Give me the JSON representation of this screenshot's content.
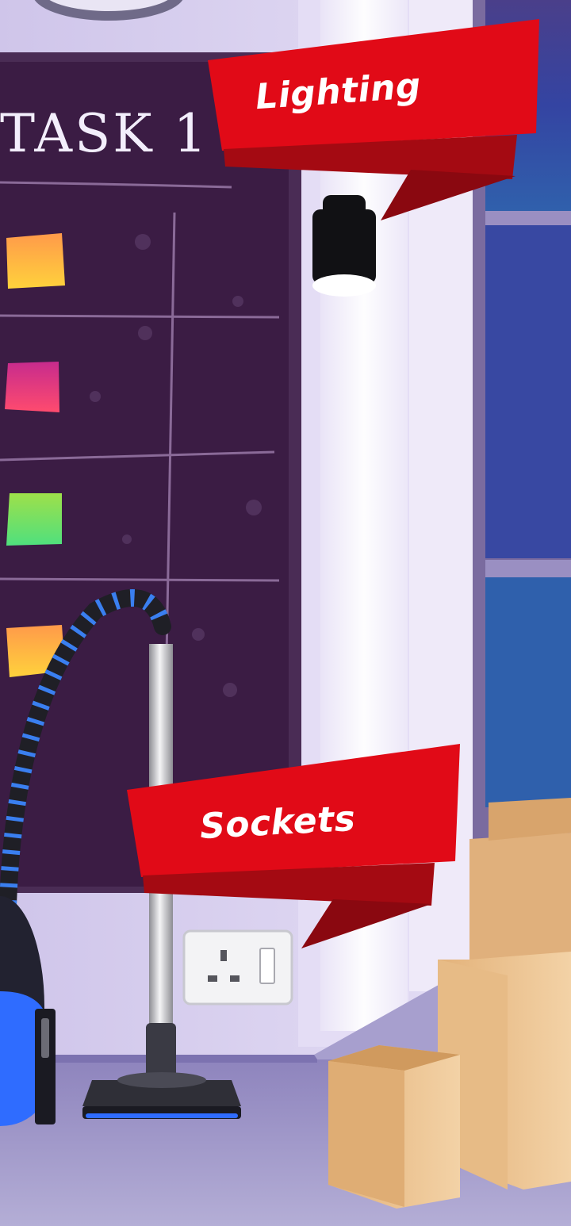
{
  "board": {
    "title": "TASK 1"
  },
  "hotspots": {
    "lighting": {
      "label": "Lighting",
      "icon": "ceiling-spotlight-icon"
    },
    "sockets": {
      "label": "Sockets",
      "icon": "wall-socket-icon"
    }
  },
  "colors": {
    "banner_red": "#e10a17",
    "banner_dark_red": "#9b0a10",
    "board_purple": "#3b1c44",
    "wall_lavender": "#d8d0ec",
    "window_blue": "#3448a6",
    "floor_purple": "#9c94c6"
  },
  "sticky_notes": [
    {
      "color": "#ffb340",
      "icon": "orange-sticky-note"
    },
    {
      "color": "#e2307f",
      "icon": "pink-sticky-note"
    },
    {
      "color": "#58d35a",
      "icon": "green-sticky-note"
    },
    {
      "color": "#ffb340",
      "icon": "orange-sticky-note"
    }
  ]
}
